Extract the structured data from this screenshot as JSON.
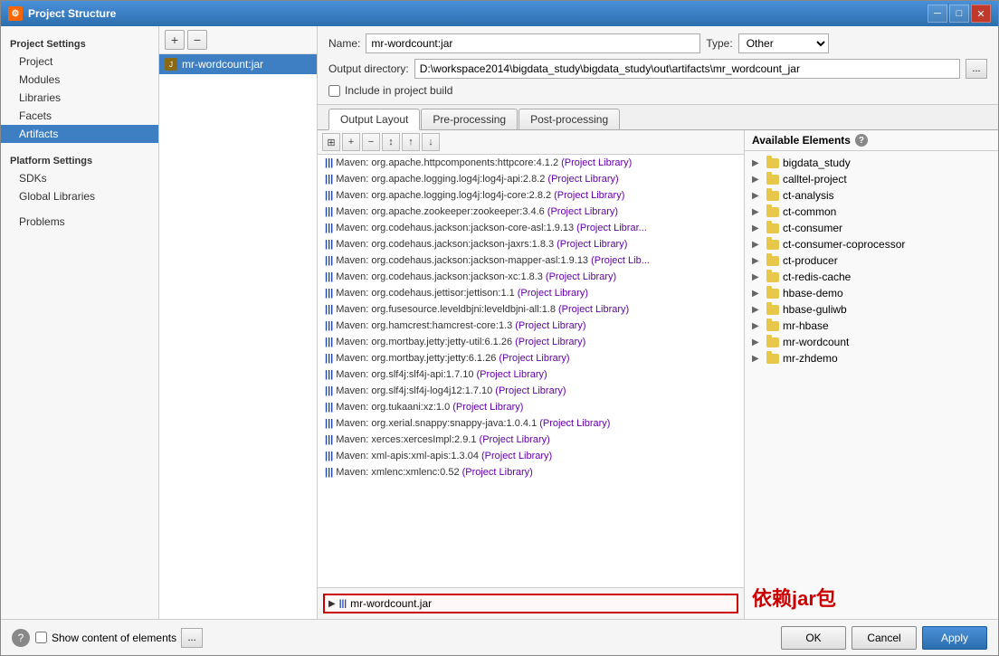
{
  "window": {
    "title": "Project Structure",
    "icon": "⚙"
  },
  "sidebar": {
    "project_settings_header": "Project Settings",
    "platform_settings_header": "Platform Settings",
    "problems_label": "Problems",
    "items": [
      {
        "label": "Project",
        "id": "project"
      },
      {
        "label": "Modules",
        "id": "modules"
      },
      {
        "label": "Libraries",
        "id": "libraries"
      },
      {
        "label": "Facets",
        "id": "facets"
      },
      {
        "label": "Artifacts",
        "id": "artifacts",
        "active": true
      },
      {
        "label": "SDKs",
        "id": "sdks"
      },
      {
        "label": "Global Libraries",
        "id": "global-libraries"
      }
    ]
  },
  "artifact": {
    "name": "mr-wordcount:jar",
    "list_item": "mr-wordcount:jar"
  },
  "form": {
    "name_label": "Name:",
    "name_value": "mr-wordcount:jar",
    "type_label": "Type:",
    "type_value": "Other",
    "output_dir_label": "Output directory:",
    "output_dir_value": "D:\\workspace2014\\bigdata_study\\bigdata_study\\out\\artifacts\\mr_wordcount_jar",
    "include_label": "Include in project build",
    "browse_label": "..."
  },
  "tabs": [
    {
      "label": "Output Layout",
      "active": true
    },
    {
      "label": "Pre-processing"
    },
    {
      "label": "Post-processing"
    }
  ],
  "layout_toolbar": {
    "buttons": [
      {
        "label": "⊞",
        "title": "show-content"
      },
      {
        "label": "+",
        "title": "add"
      },
      {
        "label": "−",
        "title": "remove"
      },
      {
        "label": "↕",
        "title": "sort"
      },
      {
        "label": "↑",
        "title": "move-up"
      },
      {
        "label": "↓",
        "title": "move-down"
      }
    ]
  },
  "dependencies": [
    {
      "text": "Maven: org.apache.httpcomponents:httpcore:4.1.2",
      "library": "(Project Library)"
    },
    {
      "text": "Maven: org.apache.logging.log4j:log4j-api:2.8.2",
      "library": "(Project Library)"
    },
    {
      "text": "Maven: org.apache.logging.log4j:log4j-core:2.8.2",
      "library": "(Project Library)"
    },
    {
      "text": "Maven: org.apache.zookeeper:zookeeper:3.4.6",
      "library": "(Project Library)"
    },
    {
      "text": "Maven: org.codehaus.jackson:jackson-core-asl:1.9.13",
      "library": "(Project Librar..."
    },
    {
      "text": "Maven: org.codehaus.jackson:jackson-jaxrs:1.8.3",
      "library": "(Project Library)"
    },
    {
      "text": "Maven: org.codehaus.jackson:jackson-mapper-asl:1.9.13",
      "library": "(Project Lib..."
    },
    {
      "text": "Maven: org.codehaus.jackson:jackson-xc:1.8.3",
      "library": "(Project Library)"
    },
    {
      "text": "Maven: org.codehaus.jettisor:jettison:1.1",
      "library": "(Project Library)"
    },
    {
      "text": "Maven: org.fusesource.leveldbjni:leveldbjni-all:1.8",
      "library": "(Project Library)"
    },
    {
      "text": "Maven: org.hamcrest:hamcrest-core:1.3",
      "library": "(Project Library)"
    },
    {
      "text": "Maven: org.mortbay.jetty:jetty-util:6.1.26",
      "library": "(Project Library)"
    },
    {
      "text": "Maven: org.mortbay.jetty:jetty:6.1.26",
      "library": "(Project Library)"
    },
    {
      "text": "Maven: org.slf4j:slf4j-api:1.7.10",
      "library": "(Project Library)"
    },
    {
      "text": "Maven: org.slf4j:slf4j-log4j12:1.7.10",
      "library": "(Project Library)"
    },
    {
      "text": "Maven: org.tukaani:xz:1.0",
      "library": "(Project Library)"
    },
    {
      "text": "Maven: org.xerial.snappy:snappy-java:1.0.4.1",
      "library": "(Project Library)"
    },
    {
      "text": "Maven: xerces:xercesImpl:2.9.1",
      "library": "(Project Library)"
    },
    {
      "text": "Maven: xml-apis:xml-apis:1.3.04",
      "library": "(Project Library)"
    },
    {
      "text": "Maven: xmlenc:xmlenc:0.52",
      "library": "(Project Library)"
    }
  ],
  "output_item": {
    "label": "mr-wordcount.jar"
  },
  "available_elements": {
    "header": "Available Elements",
    "help_icon": "?",
    "items": [
      {
        "label": "bigdata_study",
        "has_arrow": true
      },
      {
        "label": "calltel-project",
        "has_arrow": true
      },
      {
        "label": "ct-analysis",
        "has_arrow": true
      },
      {
        "label": "ct-common",
        "has_arrow": true
      },
      {
        "label": "ct-consumer",
        "has_arrow": true
      },
      {
        "label": "ct-consumer-coprocessor",
        "has_arrow": true
      },
      {
        "label": "ct-producer",
        "has_arrow": true
      },
      {
        "label": "ct-redis-cache",
        "has_arrow": true
      },
      {
        "label": "hbase-demo",
        "has_arrow": true
      },
      {
        "label": "hbase-guliwb",
        "has_arrow": true
      },
      {
        "label": "mr-hbase",
        "has_arrow": true
      },
      {
        "label": "mr-wordcount",
        "has_arrow": true
      },
      {
        "label": "mr-zhdemo",
        "has_arrow": true
      }
    ]
  },
  "annotation": {
    "text": "依赖jar包"
  },
  "bottom": {
    "show_content_label": "Show content of elements",
    "browse_label": "...",
    "ok_label": "OK",
    "cancel_label": "Cancel",
    "apply_label": "Apply",
    "help_icon": "?"
  }
}
